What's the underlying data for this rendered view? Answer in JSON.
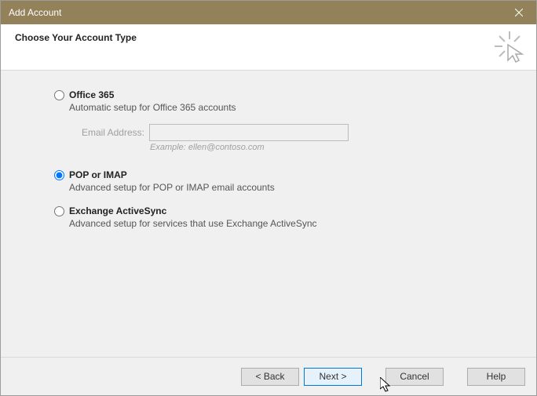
{
  "titlebar": {
    "title": "Add Account"
  },
  "header": {
    "title": "Choose Your Account Type"
  },
  "options": {
    "office365": {
      "label": "Office 365",
      "description": "Automatic setup for Office 365 accounts",
      "email_label": "Email Address:",
      "email_value": "",
      "email_example": "Example: ellen@contoso.com"
    },
    "pop_imap": {
      "label": "POP or IMAP",
      "description": "Advanced setup for POP or IMAP email accounts"
    },
    "eas": {
      "label": "Exchange ActiveSync",
      "description": "Advanced setup for services that use Exchange ActiveSync"
    }
  },
  "buttons": {
    "back": "< Back",
    "next": "Next >",
    "cancel": "Cancel",
    "help": "Help"
  }
}
